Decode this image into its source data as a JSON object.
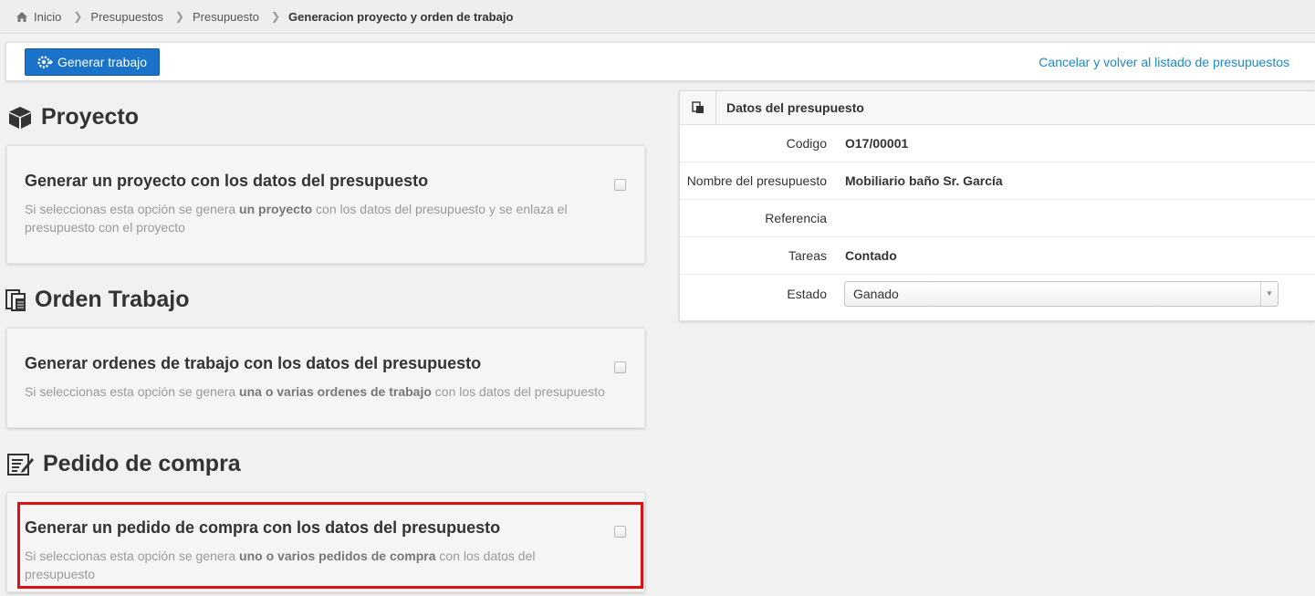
{
  "breadcrumb": {
    "items": [
      "Inicio",
      "Presupuestos",
      "Presupuesto"
    ],
    "current": "Generacion proyecto y orden de trabajo"
  },
  "toolbar": {
    "generate_label": "Generar trabajo",
    "cancel_label": "Cancelar y volver al listado de presupuestos"
  },
  "sections": {
    "proyecto": {
      "title": "Proyecto",
      "card_title": "Generar un proyecto con los datos del presupuesto",
      "desc_pre": "Si seleccionas esta opción se genera ",
      "desc_bold": "un proyecto",
      "desc_post": " con los datos del presupuesto y se enlaza el presupuesto con el proyecto"
    },
    "orden": {
      "title": "Orden Trabajo",
      "card_title": "Generar ordenes de trabajo con los datos del presupuesto",
      "desc_pre": "Si seleccionas esta opción se genera ",
      "desc_bold": "una o varias ordenes de trabajo",
      "desc_post": " con los datos del presupuesto"
    },
    "pedido": {
      "title": "Pedido de compra",
      "card_title": "Generar un pedido de compra con los datos del presupuesto",
      "desc_pre": "Si seleccionas esta opción se genera ",
      "desc_bold": "uno o varios pedidos de compra",
      "desc_post": " con los datos del presupuesto"
    }
  },
  "panel": {
    "title": "Datos del presupuesto",
    "rows": [
      {
        "label": "Codigo",
        "value": "O17/00001"
      },
      {
        "label": "Nombre del presupuesto",
        "value": "Mobiliario baño Sr. García"
      },
      {
        "label": "Referencia",
        "value": ""
      },
      {
        "label": "Tareas",
        "value": "Contado"
      },
      {
        "label": "Estado",
        "value": "Ganado"
      }
    ]
  },
  "colors": {
    "primary": "#1a72c9",
    "link": "#1a8bc9",
    "highlight": "#e01010"
  }
}
